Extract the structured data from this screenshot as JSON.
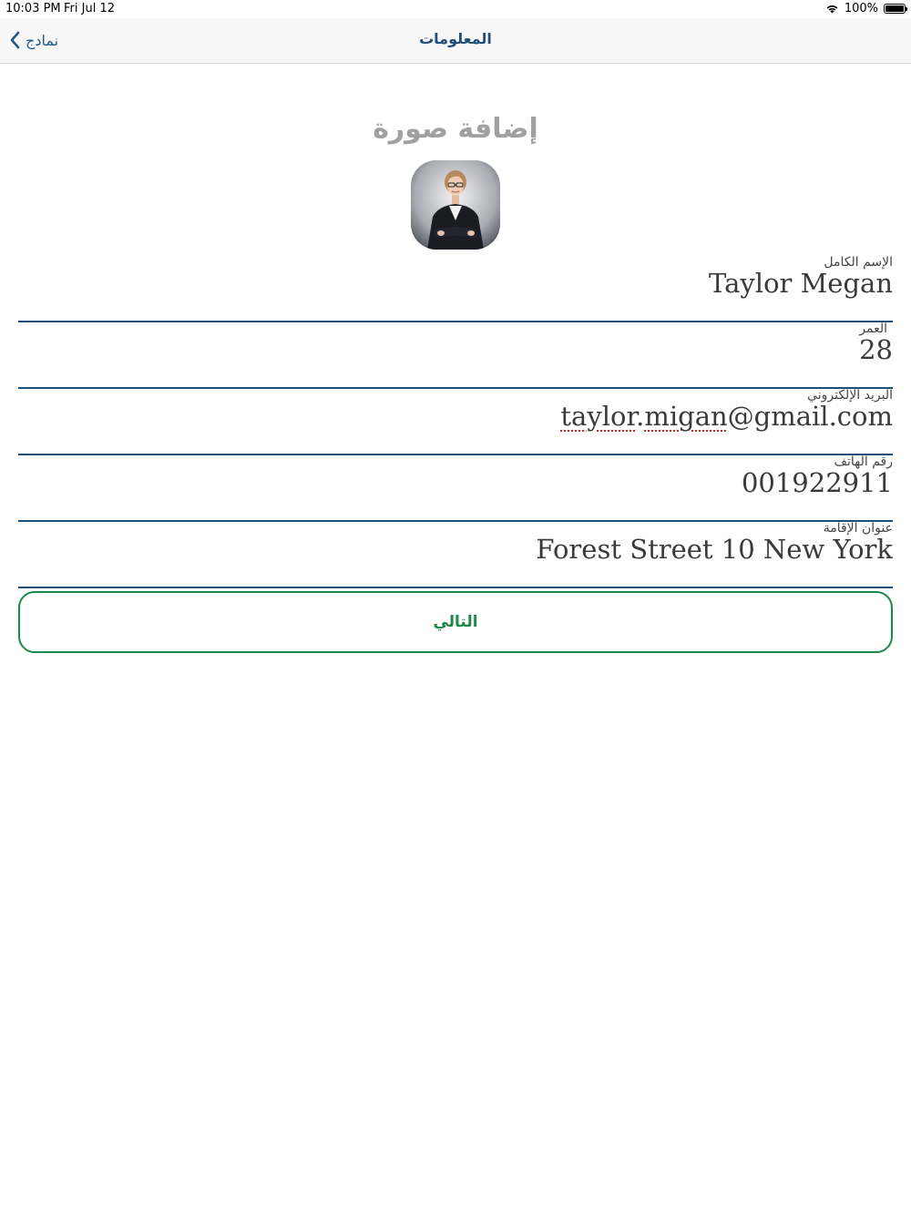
{
  "status_bar": {
    "time": "10:03 PM",
    "date": "Fri Jul 12",
    "battery": "100%"
  },
  "nav": {
    "back_label": "نمادج",
    "title": "المعلومات"
  },
  "photo": {
    "title": "إضافة صورة"
  },
  "form": {
    "full_name": {
      "label": "الإسم الكامل",
      "value": "Taylor Megan"
    },
    "age": {
      "label": "العمر",
      "value": "28"
    },
    "email": {
      "label": "البريد الإلكتروني",
      "value_part1": "taylor",
      "value_part2": ".",
      "value_part3": "migan",
      "value_part4": "@gmail.com"
    },
    "phone": {
      "label": "رقم الهاتف",
      "value": "001922911"
    },
    "address": {
      "label": "عنوان الإقامة",
      "value": "Forest Street 10 New York"
    }
  },
  "next_label": "التالي",
  "colors": {
    "accent": "#1f4e79",
    "button": "#1a8a4a",
    "title_gray": "#a0a0a0"
  }
}
